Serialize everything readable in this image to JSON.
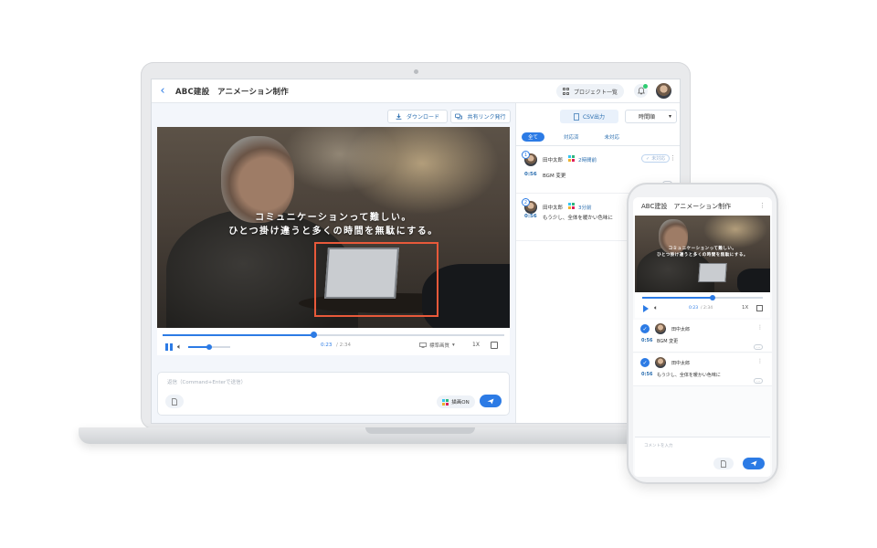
{
  "header": {
    "back_icon": "chevron-left-icon",
    "title": "ABC建設　アニメーション制作",
    "project_list_label": "プロジェクト一覧",
    "notification_icon": "bell-icon"
  },
  "toolbar": {
    "download_label": "ダウンロード",
    "share_link_label": "共有リンク発行"
  },
  "video": {
    "caption_line1": "コミュニケーションって難しい。",
    "caption_line2": "ひとつ掛け違うと多くの時間を無駄にする。",
    "progress": 0.44,
    "volume": 0.5,
    "current_time": "0:23",
    "total_time": "/ 2:34",
    "quality_label": "標準画質",
    "speed_label": "1X"
  },
  "composer": {
    "placeholder": "返信（Command+Enterで送信）",
    "draw_label": "描画ON"
  },
  "panel": {
    "csv_label": "CSV出力",
    "sort_label": "時間順",
    "filter_tabs": [
      "全て",
      "対応済",
      "未対応"
    ],
    "comments": [
      {
        "num": "1",
        "name": "田中太郎",
        "ago": "2時間前",
        "status": "未対応",
        "time": "0:56",
        "text": "BGM 変更"
      },
      {
        "num": "2",
        "name": "田中太郎",
        "ago": "3分前",
        "time": "0:56",
        "text": "もう少し、全体を暖かい色味に"
      }
    ]
  },
  "phone": {
    "title": "ABC建設　アニメーション制作",
    "caption_line1": "コミュニケーションって難しい。",
    "caption_line2": "ひとつ掛け違うと多くの時間を無駄にする。",
    "current_time": "0:23",
    "total_time": "/ 2:34",
    "speed_label": "1X",
    "progress": 0.58,
    "comments": [
      {
        "name": "田中太郎",
        "time": "0:56",
        "text": "BGM 変更"
      },
      {
        "name": "田中太郎",
        "time": "0:56",
        "text": "もう少し、全体を暖かい色味に"
      }
    ],
    "input_placeholder": "コメントを入力"
  },
  "colors": {
    "accent": "#2c7be5",
    "highlight": "#e8593a"
  }
}
